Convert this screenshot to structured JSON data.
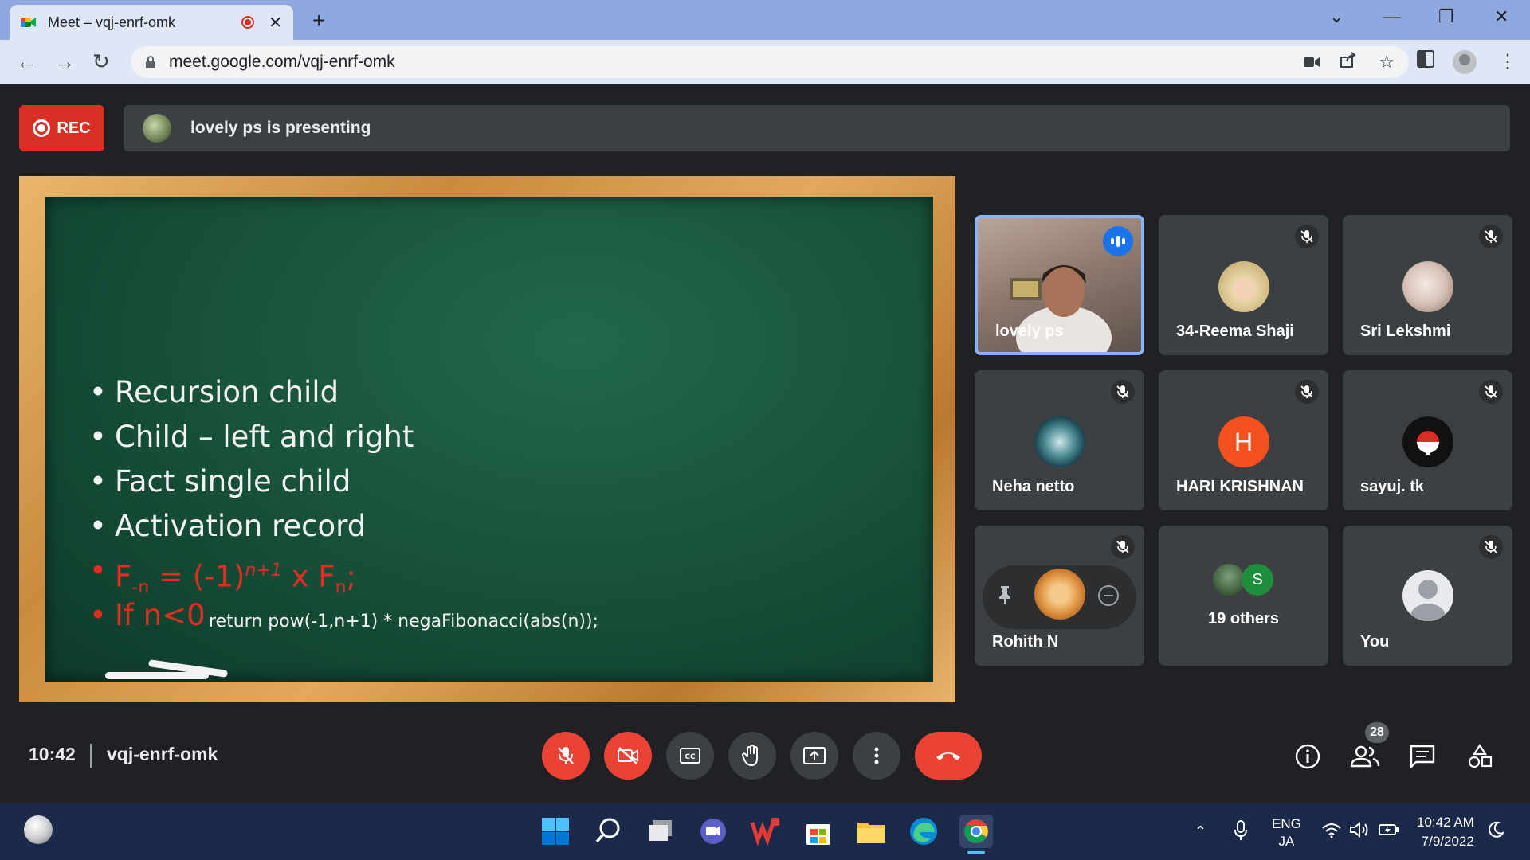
{
  "browser": {
    "tab_title": "Meet – vqj-enrf-omk",
    "new_tab": "+",
    "url": "meet.google.com/vqj-enrf-omk",
    "close_tab": "✕",
    "window_controls": {
      "dropdown": "⌄",
      "minimize": "—",
      "restore": "❐",
      "close": "✕"
    }
  },
  "meet": {
    "rec_label": "REC",
    "presenting_text": "lovely ps is presenting",
    "slide": {
      "bullets": [
        "Recursion child",
        "Child – left and right",
        "Fact single child",
        "Activation record"
      ],
      "formula": {
        "f": "F",
        "sub1": "-n",
        "eq": " = (-1)",
        "sup": "n+1",
        "mid": " x F",
        "sub2": "n",
        "end": ";"
      },
      "condition": "If n<0",
      "code": "return pow(-1,n+1) * negaFibonacci(abs(n));"
    },
    "participants": [
      {
        "name": "lovely ps",
        "speaking": true
      },
      {
        "name": "34-Reema Shaji",
        "muted": true
      },
      {
        "name": "Sri Lekshmi",
        "muted": true
      },
      {
        "name": "Neha netto",
        "muted": true
      },
      {
        "name": "HARI KRISHNAN",
        "initial": "H",
        "muted": true
      },
      {
        "name": "sayuj. tk",
        "muted": true
      },
      {
        "name": "Rohith N",
        "muted": true
      },
      {
        "name": "19 others",
        "initial": "S"
      },
      {
        "name": "You",
        "muted": true
      }
    ],
    "time": "10:42",
    "meeting_code": "vqj-enrf-omk",
    "people_count": "28"
  },
  "taskbar": {
    "lang_top": "ENG",
    "lang_bottom": "JA",
    "time": "10:42 AM",
    "date": "7/9/2022"
  },
  "colors": {
    "accent": "#8ab4f8",
    "danger": "#ea4335",
    "tile": "#3c4043",
    "background": "#202124"
  }
}
